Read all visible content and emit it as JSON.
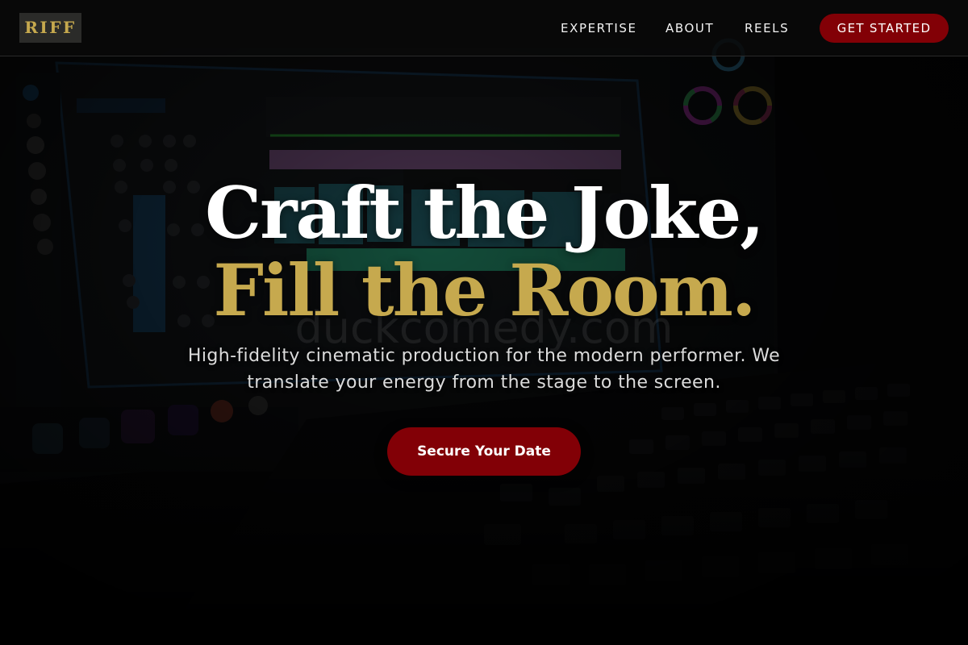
{
  "nav": {
    "logo": "RIFF",
    "links": [
      "EXPERTISE",
      "ABOUT",
      "REELS"
    ],
    "cta": "GET STARTED"
  },
  "hero": {
    "line1": "Craft the Joke,",
    "line2": "Fill the Room.",
    "watermark": "duckcomedy.com",
    "subtitle": "High-fidelity cinematic production for the modern performer. We translate your energy from the stage to the screen.",
    "cta": "Secure Your Date"
  },
  "colors": {
    "accent_gold": "#c6a94e",
    "cta_red": "#820006",
    "background": "#060606"
  }
}
